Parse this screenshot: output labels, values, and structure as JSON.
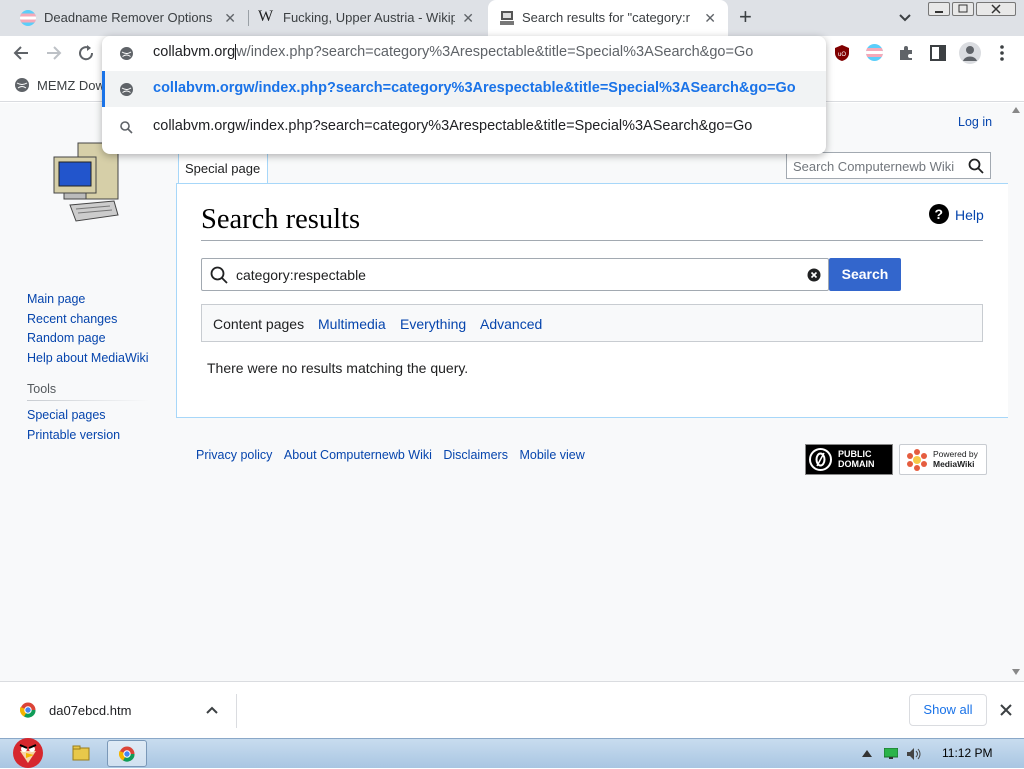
{
  "tabs": [
    {
      "title": "Deadname Remover Options",
      "icon": "trans-flag-icon"
    },
    {
      "title": "Fucking, Upper Austria - Wikip",
      "icon": "wikipedia-icon"
    },
    {
      "title": "Search results for \"category:re",
      "icon": "wiki-computer-icon"
    }
  ],
  "window": {
    "new_tab": "+",
    "tab_close": "✕"
  },
  "omnibox": {
    "typed_prefix": "collabvm.org",
    "typed_suffix": "w/index.php?search=category%3Arespectable&title=Special%3ASearch&go=Go",
    "suggestions": [
      {
        "text": "collabvm.orgw/index.php?search=category%3Arespectable&title=Special%3ASearch&go=Go",
        "icon": "globe-icon"
      },
      {
        "text": "collabvm.orgw/index.php?search=category%3Arespectable&title=Special%3ASearch&go=Go",
        "icon": "search-icon"
      }
    ]
  },
  "bookmarks": [
    {
      "label": "MEMZ Dow"
    }
  ],
  "wiki": {
    "login": "Log in",
    "tab_special": "Special page",
    "search_placeholder": "Search Computernewb Wiki",
    "heading": "Search results",
    "help": "Help",
    "query": "category:respectable",
    "search_button": "Search",
    "filters": [
      "Content pages",
      "Multimedia",
      "Everything",
      "Advanced"
    ],
    "no_results": "There were no results matching the query.",
    "nav": [
      "Main page",
      "Recent changes",
      "Random page",
      "Help about MediaWiki"
    ],
    "tools_heading": "Tools",
    "tools": [
      "Special pages",
      "Printable version"
    ],
    "footer": [
      "Privacy policy",
      "About Computernewb Wiki",
      "Disclaimers",
      "Mobile view"
    ],
    "badge_pd": [
      "PUBLIC",
      "DOMAIN"
    ],
    "badge_mw": [
      "Powered by",
      "MediaWiki"
    ]
  },
  "download": {
    "filename": "da07ebcd.htm",
    "show_all": "Show all"
  },
  "taskbar": {
    "time": "11:12 PM"
  },
  "colors": {
    "link": "#0645ad",
    "accent": "#3366cc",
    "chrome_bg": "#dee1e6"
  }
}
